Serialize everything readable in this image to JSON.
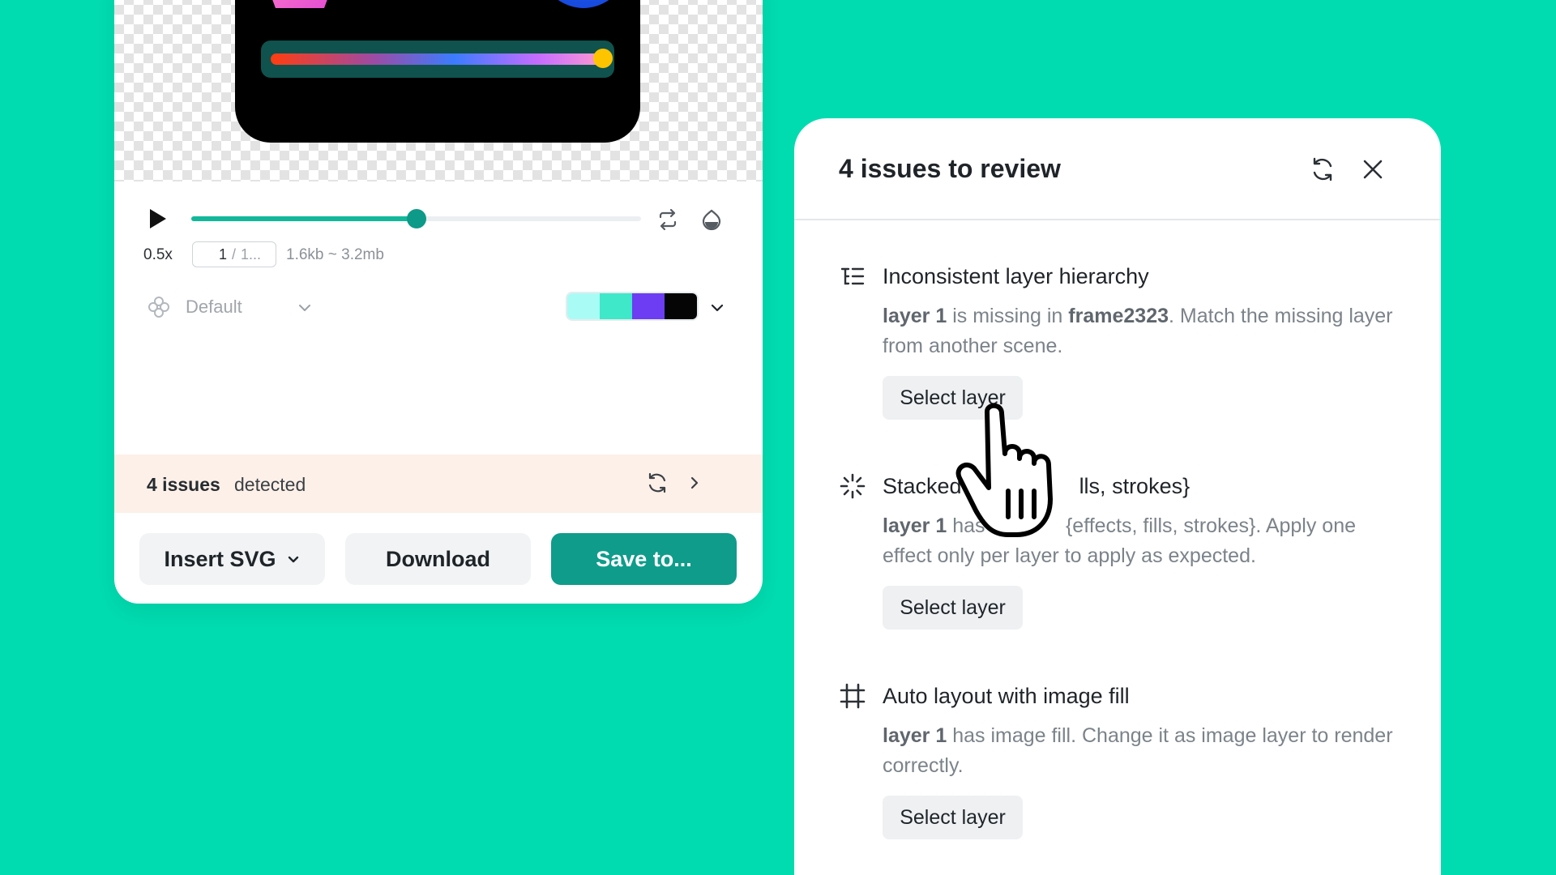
{
  "player": {
    "speed": "0.5x",
    "frame_current": "1",
    "frame_separator": "/",
    "frame_total": "1...",
    "size_range": "1.6kb ~ 3.2mb",
    "progress": 0.5
  },
  "preset": {
    "label": "Default",
    "icon": "flower-icon"
  },
  "palette": {
    "colors": [
      "#a9fbf5",
      "#3ee8c9",
      "#6c3df2",
      "#050505"
    ]
  },
  "issues_banner": {
    "count": "4 issues",
    "text": "detected"
  },
  "actions": {
    "insert_label": "Insert SVG",
    "download_label": "Download",
    "save_label": "Save to..."
  },
  "panel": {
    "title": "4 issues to review",
    "issues": [
      {
        "icon": "layer-hierarchy-icon",
        "title": "Inconsistent layer hierarchy",
        "desc_parts": [
          "layer 1",
          " is missing in ",
          "frame2323",
          ". Match the missing layer from another scene."
        ],
        "button": "Select layer"
      },
      {
        "icon": "loader-icon",
        "title_visible_start": "Stacked",
        "title_visible_end": "lls, strokes}",
        "desc_parts": [
          "layer 1",
          " has s",
          "{effects, fills, strokes}. Apply one effect only per layer to apply as expected."
        ],
        "button": "Select layer"
      },
      {
        "icon": "frame-icon",
        "title": "Auto layout with image fill",
        "desc_parts": [
          "layer 1",
          " has image fill. Change it as image layer to render correctly."
        ],
        "button": "Select layer"
      }
    ]
  },
  "colors": {
    "background": "#00dcb0",
    "accent": "#0f9c8b",
    "banner": "#fdf0e8"
  }
}
